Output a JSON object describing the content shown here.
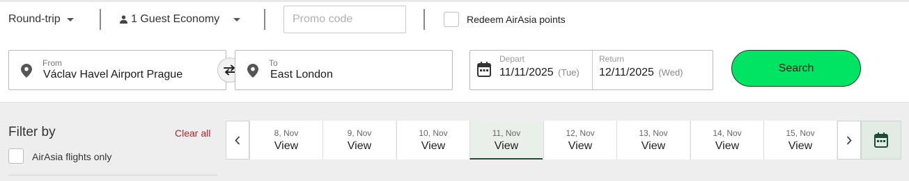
{
  "trip_type": {
    "label": "Round-trip"
  },
  "guests": {
    "label": "1 Guest Economy"
  },
  "promo": {
    "placeholder": "Promo code"
  },
  "redeem": {
    "label": "Redeem AirAsia points"
  },
  "from": {
    "label": "From",
    "value": "Václav Havel Airport Prague"
  },
  "to": {
    "label": "To",
    "value": "East London"
  },
  "depart": {
    "label": "Depart",
    "date": "11/11/2025",
    "dow": "(Tue)"
  },
  "return": {
    "label": "Return",
    "date": "12/11/2025",
    "dow": "(Wed)"
  },
  "search": {
    "label": "Search"
  },
  "filter": {
    "title": "Filter by",
    "clear_all": "Clear all",
    "airasia_only": "AirAsia flights only"
  },
  "date_strip": {
    "days": [
      {
        "date": "8, Nov",
        "value": "View",
        "selected": false
      },
      {
        "date": "9, Nov",
        "value": "View",
        "selected": false
      },
      {
        "date": "10, Nov",
        "value": "View",
        "selected": false
      },
      {
        "date": "11, Nov",
        "value": "View",
        "selected": true
      },
      {
        "date": "12, Nov",
        "value": "View",
        "selected": false
      },
      {
        "date": "13, Nov",
        "value": "View",
        "selected": false
      },
      {
        "date": "14, Nov",
        "value": "View",
        "selected": false
      },
      {
        "date": "15, Nov",
        "value": "View",
        "selected": false
      }
    ]
  },
  "colors": {
    "search_green": "#00e463",
    "clear_all_red": "#b3202a",
    "selected_day_bg": "#e9efe9",
    "selected_underline": "#1b4d37"
  }
}
